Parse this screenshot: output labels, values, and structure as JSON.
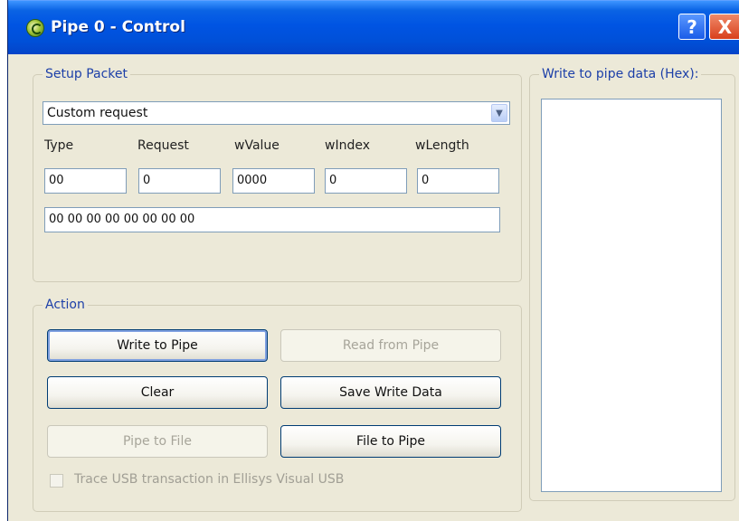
{
  "window": {
    "title": "Pipe 0 - Control",
    "help_glyph": "?",
    "close_glyph": "X"
  },
  "setup": {
    "group_label": "Setup Packet",
    "request_select": "Custom request",
    "labels": {
      "type": "Type",
      "request": "Request",
      "wvalue": "wValue",
      "windex": "wIndex",
      "wlength": "wLength"
    },
    "values": {
      "type": "00",
      "request": "0",
      "wvalue": "0000",
      "windex": "0",
      "wlength": "0"
    },
    "packet_bytes": "00 00 00 00 00 00 00 00"
  },
  "action": {
    "group_label": "Action",
    "write_to_pipe": "Write to Pipe",
    "read_from_pipe": "Read from Pipe",
    "clear": "Clear",
    "save_write_data": "Save Write Data",
    "pipe_to_file": "Pipe to File",
    "file_to_pipe": "File to Pipe",
    "trace_label": "Trace USB transaction in Ellisys Visual USB"
  },
  "write_panel": {
    "label": "Write to pipe data (Hex):"
  },
  "colors": {
    "title_bar": "#0054e3",
    "window_bg": "#ece9d8",
    "group_label": "#1c3fa8",
    "close_button": "#d8401c"
  }
}
